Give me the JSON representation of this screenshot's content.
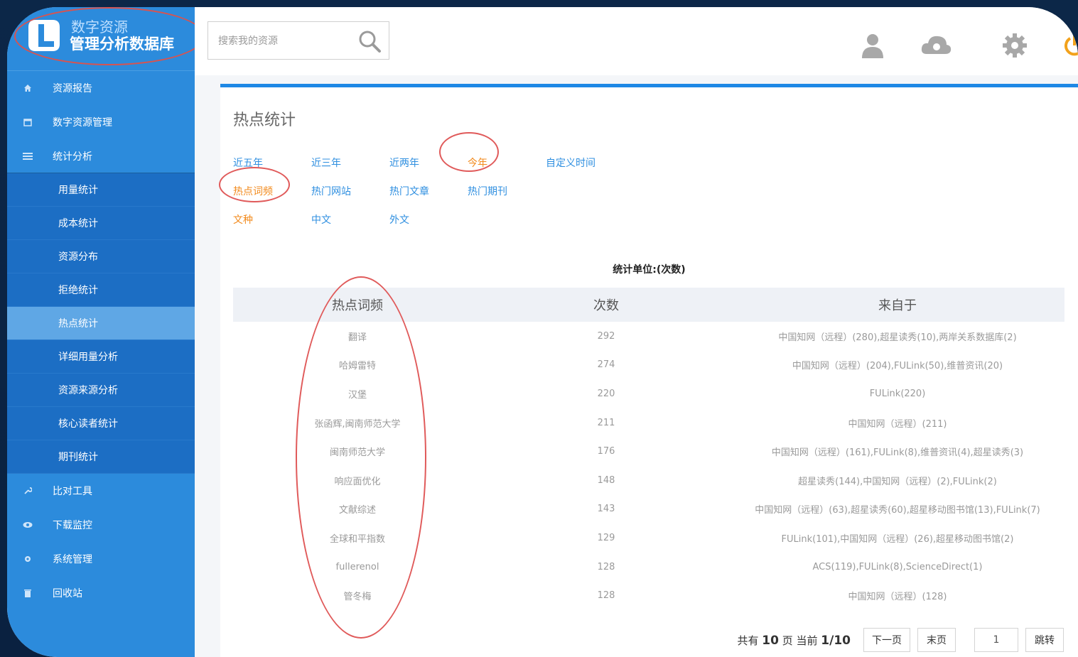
{
  "app": {
    "logo_line1": "数字资源",
    "logo_line2": "管理分析数据库"
  },
  "sidebar": {
    "items": [
      {
        "label": "资源报告",
        "icon": "home-icon"
      },
      {
        "label": "数字资源管理",
        "icon": "calendar-icon"
      },
      {
        "label": "统计分析",
        "icon": "list-icon"
      }
    ],
    "sub_items": [
      {
        "label": "用量统计"
      },
      {
        "label": "成本统计"
      },
      {
        "label": "资源分布"
      },
      {
        "label": "拒绝统计"
      },
      {
        "label": "热点统计",
        "active": true
      },
      {
        "label": "详细用量分析"
      },
      {
        "label": "资源来源分析"
      },
      {
        "label": "核心读者统计"
      },
      {
        "label": "期刊统计"
      }
    ],
    "bottom_items": [
      {
        "label": "比对工具",
        "icon": "wrench-icon"
      },
      {
        "label": "下载监控",
        "icon": "eye-icon"
      },
      {
        "label": "系统管理",
        "icon": "gear-icon"
      },
      {
        "label": "回收站",
        "icon": "trash-icon"
      }
    ]
  },
  "header": {
    "search_placeholder": "搜索我的资源"
  },
  "main": {
    "title": "热点统计",
    "time_filters": [
      "近五年",
      "近三年",
      "近两年",
      "今年",
      "自定义时间"
    ],
    "type_filters": [
      "热点词频",
      "热门网站",
      "热门文章",
      "热门期刊"
    ],
    "lang_filters": [
      "文种",
      "中文",
      "外文"
    ],
    "unit_label": "统计单位:(次数)",
    "table": {
      "headers": [
        "热点词频",
        "次数",
        "来自于"
      ],
      "rows": [
        [
          "翻译",
          "292",
          "中国知网（远程）(280),超星读秀(10),两岸关系数据库(2)"
        ],
        [
          "哈姆雷特",
          "274",
          "中国知网（远程）(204),FULink(50),维普资讯(20)"
        ],
        [
          "汉堡",
          "220",
          "FULink(220)"
        ],
        [
          "张函辉,闽南师范大学",
          "211",
          "中国知网（远程）(211)"
        ],
        [
          "闽南师范大学",
          "176",
          "中国知网（远程）(161),FULink(8),维普资讯(4),超星读秀(3)"
        ],
        [
          "响应面优化",
          "148",
          "超星读秀(144),中国知网（远程）(2),FULink(2)"
        ],
        [
          "文献综述",
          "143",
          "中国知网（远程）(63),超星读秀(60),超星移动图书馆(13),FULink(7)"
        ],
        [
          "全球和平指数",
          "129",
          "FULink(101),中国知网（远程）(26),超星移动图书馆(2)"
        ],
        [
          "fullerenol",
          "128",
          "ACS(119),FULink(8),ScienceDirect(1)"
        ],
        [
          "管冬梅",
          "128",
          "中国知网（远程）(128)"
        ]
      ]
    },
    "pager": {
      "prefix": "共有",
      "total": "10",
      "mid": "页 当前",
      "current": "1/10",
      "next": "下一页",
      "last": "末页",
      "page_input": "1",
      "jump": "跳转"
    }
  },
  "colors": {
    "sidebar": "#2c8bdc",
    "sidebar_sub": "#1c6ec4",
    "active": "#5fa7e5",
    "link_blue": "#2f8fe0",
    "link_orange": "#f28a1c",
    "accent_bar": "#1e88e5",
    "annotation_red": "#e05a5a"
  }
}
